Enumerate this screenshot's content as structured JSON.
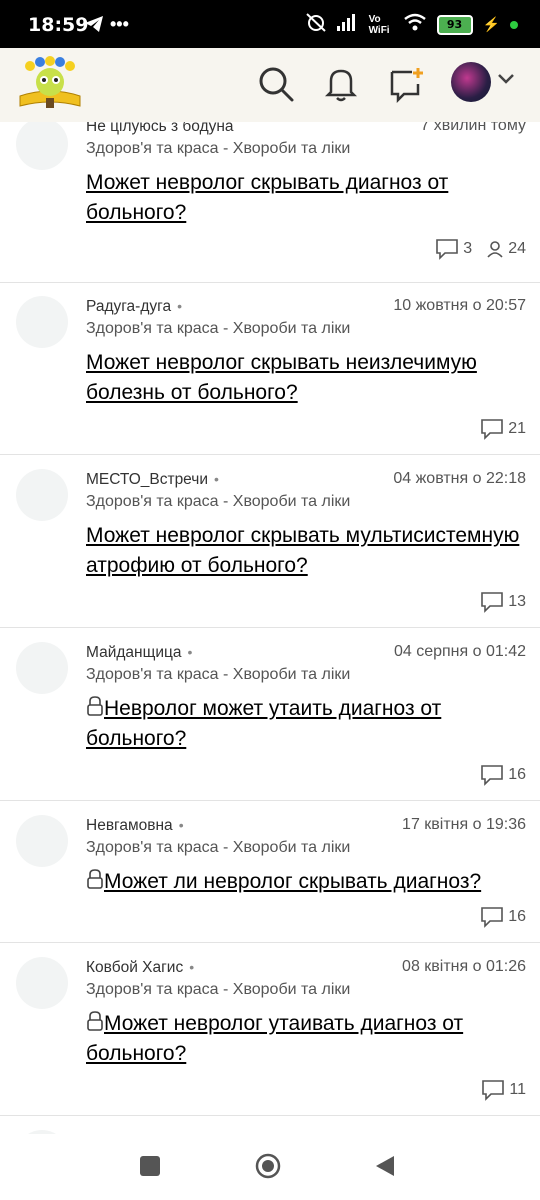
{
  "status": {
    "time": "18:59",
    "battery": "93",
    "network": "Vo WiFi"
  },
  "posts": [
    {
      "author": "Не цілуюсь з бодуна",
      "time": "7 хвилин тому",
      "category": "Здоров'я та краса - Хвороби та ліки",
      "question": "Может невролог скрывать диагноз от больного?",
      "answers": "3",
      "views": "24",
      "locked": false
    },
    {
      "author": "Радуга-дуга",
      "time": "10 жовтня о 20:57",
      "category": "Здоров'я та краса - Хвороби та ліки",
      "question": "Может невролог скрывать неизлечимую болезнь от больного?",
      "answers": "21",
      "locked": false
    },
    {
      "author": "МЕСТО_Встречи",
      "time": "04 жовтня о 22:18",
      "category": "Здоров'я та краса - Хвороби та ліки",
      "question": "Может невролог скрывать мультисистемную атрофию от больного?",
      "answers": "13",
      "locked": false
    },
    {
      "author": "Майданщица",
      "time": "04 серпня о 01:42",
      "category": "Здоров'я та краса - Хвороби та ліки",
      "question": "Невролог может утаить диагноз от больного?",
      "answers": "16",
      "locked": true
    },
    {
      "author": "Невгамовна",
      "time": "17 квітня о 19:36",
      "category": "Здоров'я та краса - Хвороби та ліки",
      "question": "Может ли невролог скрывать диагноз?",
      "answers": "16",
      "locked": true
    },
    {
      "author": "Ковбой Хагис",
      "time": "08 квітня о 01:26",
      "category": "Здоров'я та краса - Хвороби та ліки",
      "question": "Может невролог утаивать диагноз от больного?",
      "answers": "11",
      "locked": true
    }
  ]
}
